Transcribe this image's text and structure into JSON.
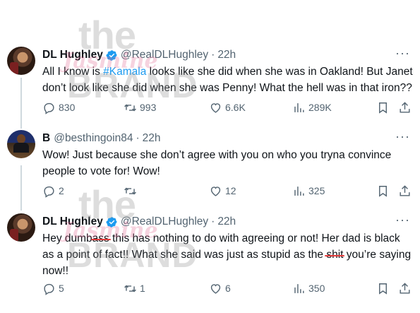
{
  "tweets": [
    {
      "name": "DL Hughley",
      "verified": true,
      "handle": "@RealDLHughley",
      "time": "22h",
      "text_parts": [
        "All I know is ",
        "#Kamala",
        " looks like she did when she was in Oakland! But Janet don’t look like she did when she was Penny! What the hell was in that iron??"
      ],
      "replies": "830",
      "retweets": "993",
      "likes": "6.6K",
      "views": "289K"
    },
    {
      "name": "B",
      "verified": false,
      "handle": "@besthingoin84",
      "time": "22h",
      "text": "Wow! Just because she don’t agree with you on who you tryna convince people to vote for! Wow!",
      "replies": "2",
      "retweets": "",
      "likes": "12",
      "views": "325"
    },
    {
      "name": "DL Hughley",
      "verified": true,
      "handle": "@RealDLHughley",
      "time": "22h",
      "text_parts": [
        "Hey dumb",
        "ass",
        " this has nothing to do with agreeing or not! Her dad is black as a point of fact!! What she said was just as stupid as the ",
        "shit",
        " you’re saying now!!"
      ],
      "replies": "5",
      "retweets": "1",
      "likes": "6",
      "views": "350"
    }
  ],
  "watermark": {
    "line1": "the",
    "line2": "Jasmine",
    "line3": "BRAND"
  },
  "icons": {
    "more": "more-dots-icon",
    "reply": "reply-icon",
    "retweet": "retweet-icon",
    "like": "heart-icon",
    "views": "views-icon",
    "bookmark": "bookmark-icon",
    "share": "share-icon"
  },
  "colors": {
    "text": "#0f1419",
    "muted": "#536471",
    "link": "#1d9bf0",
    "verified": "#1d9bf0",
    "strike": "#e23b3b"
  }
}
